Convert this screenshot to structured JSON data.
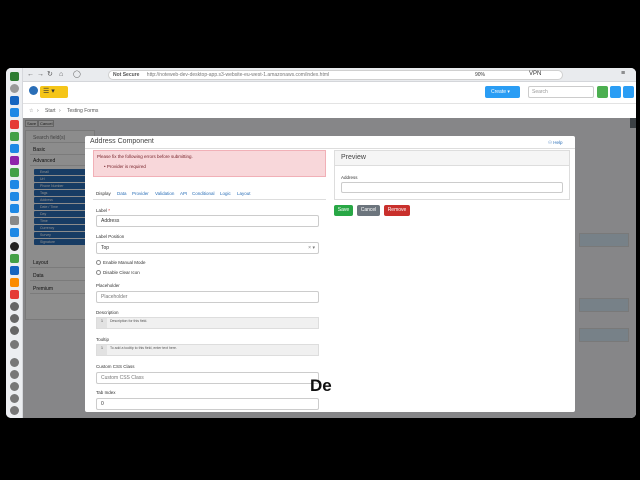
{
  "browser": {
    "security": "Not Secure",
    "url": "http://noteweb-dev-desktop-app.s3-website-eu-west-1.amazonaws.com/index.html",
    "zoom": "90%",
    "vpn": "VPN"
  },
  "header": {
    "create_label": "Create",
    "search_placeholder": "Search"
  },
  "breadcrumb": {
    "start": "Start",
    "current": "Testing Forms"
  },
  "toolbar": {
    "save_label": "Save",
    "cancel_label": "Cancel"
  },
  "builder": {
    "search_placeholder": "Search field(s)",
    "groups": [
      "Basic",
      "Advanced",
      "Layout",
      "Data",
      "Premium"
    ],
    "components": [
      "Email",
      "Url",
      "Phone Number",
      "Tags",
      "Address",
      "Date / Time",
      "Day",
      "Time",
      "Currency",
      "Survey",
      "Signature"
    ]
  },
  "modal": {
    "title": "Address Component",
    "help": "Help",
    "error_title": "Please fix the following errors before submitting.",
    "error_item": "Provider is required",
    "tabs": [
      "Display",
      "Data",
      "Provider",
      "Validation",
      "API",
      "Conditional",
      "Logic",
      "Layout"
    ],
    "label_label": "Label",
    "label_value": "Address",
    "label_position_label": "Label Position",
    "label_position_value": "Top",
    "enable_manual_mode": "Enable Manual Mode",
    "disable_clear_icon": "Disable Clear Icon",
    "placeholder_label": "Placeholder",
    "placeholder_value": "Placeholder",
    "description_label": "Description",
    "description_value": "Description for this field.",
    "tooltip_label": "Tooltip",
    "tooltip_value": "To add a tooltip to this field, enter text here.",
    "custom_css_label": "Custom CSS Class",
    "custom_css_value": "Custom CSS Class",
    "tab_index_label": "Tab Index",
    "tab_index_value": "0",
    "preview_title": "Preview",
    "preview_address_label": "Address",
    "save_label": "Save",
    "cancel_label": "Cancel",
    "remove_label": "Remove"
  },
  "caption": "De",
  "colors": {
    "primary": "#2a6eb7",
    "success": "#28a745",
    "danger": "#c9302c",
    "secondary": "#6c757d",
    "error_bg": "#f8d7da",
    "header_yellow": "#f5c518",
    "header_green": "#4caf50"
  }
}
